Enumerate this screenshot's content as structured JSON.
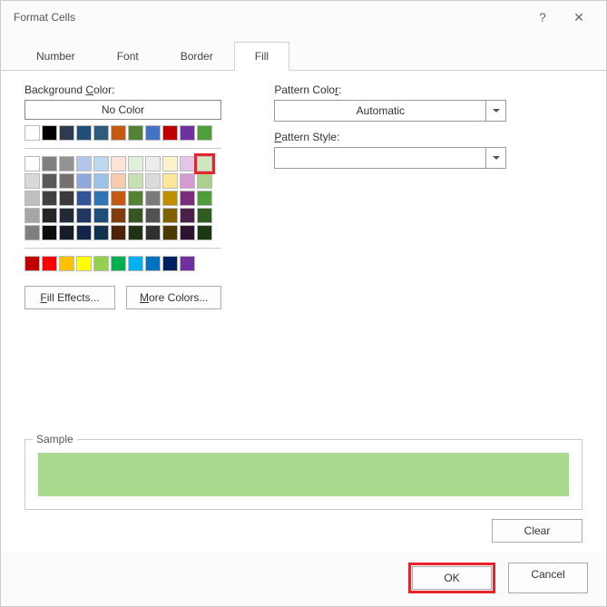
{
  "title": "Format Cells",
  "help": "?",
  "close": "✕",
  "tabs": {
    "number": "Number",
    "font": "Font",
    "border": "Border",
    "fill": "Fill"
  },
  "left": {
    "bg_label_pre": "Background ",
    "bg_label_u": "C",
    "bg_label_post": "olor:",
    "no_color": "No Color",
    "fill_effects_u": "F",
    "fill_effects_post": "ill Effects...",
    "more_colors_u": "M",
    "more_colors_post": "ore Colors..."
  },
  "right": {
    "pc_label_pre": "Pattern Colo",
    "pc_label_u": "r",
    "pc_label_post": ":",
    "automatic": "Automatic",
    "ps_label_u": "P",
    "ps_label_post": "attern Style:"
  },
  "sample_label": "Sample",
  "sample_color": "#a8d98d",
  "clear": "Clear",
  "ok": "OK",
  "cancel": "Cancel",
  "rows": {
    "r1": [
      "#ffffff",
      "#000000",
      "#2e3b4e",
      "#1f4e79",
      "#2f5c7c",
      "#c65911",
      "#548235",
      "#4472c4",
      "#c00000",
      "#7030a0",
      "#4f9e3a"
    ],
    "r2": [
      "#ffffff",
      "#808080",
      "#939393",
      "#b4c6e7",
      "#bdd7ee",
      "#fce4d6",
      "#e2efda",
      "#ededed",
      "#fff2cc",
      "#e6c6e6",
      "#cfe8c0"
    ],
    "r3": [
      "#d9d9d9",
      "#595959",
      "#757171",
      "#8ea9db",
      "#9bc2e6",
      "#f8cbad",
      "#c6e0b4",
      "#dbdbdb",
      "#ffe699",
      "#d49ad4",
      "#a9d08e"
    ],
    "r4": [
      "#bfbfbf",
      "#404040",
      "#3a3a3a",
      "#305496",
      "#2e75b6",
      "#c65911",
      "#548235",
      "#7b7b7b",
      "#bf8f00",
      "#7b2d7b",
      "#4f9e3a"
    ],
    "r5": [
      "#a6a6a6",
      "#262626",
      "#222a35",
      "#203764",
      "#1f4e78",
      "#833c0c",
      "#375623",
      "#525252",
      "#806000",
      "#4c1f4c",
      "#2f5c1f"
    ],
    "r6": [
      "#7f7f7f",
      "#0d0d0d",
      "#161c27",
      "#132448",
      "#10324d",
      "#4e2407",
      "#1f3313",
      "#2f2f2f",
      "#4d3a00",
      "#2e122e",
      "#1c3812"
    ],
    "std": [
      "#c00000",
      "#ff0000",
      "#ffc000",
      "#ffff00",
      "#92d050",
      "#00b050",
      "#00b0f0",
      "#0070c0",
      "#002060",
      "#7030a0"
    ]
  }
}
